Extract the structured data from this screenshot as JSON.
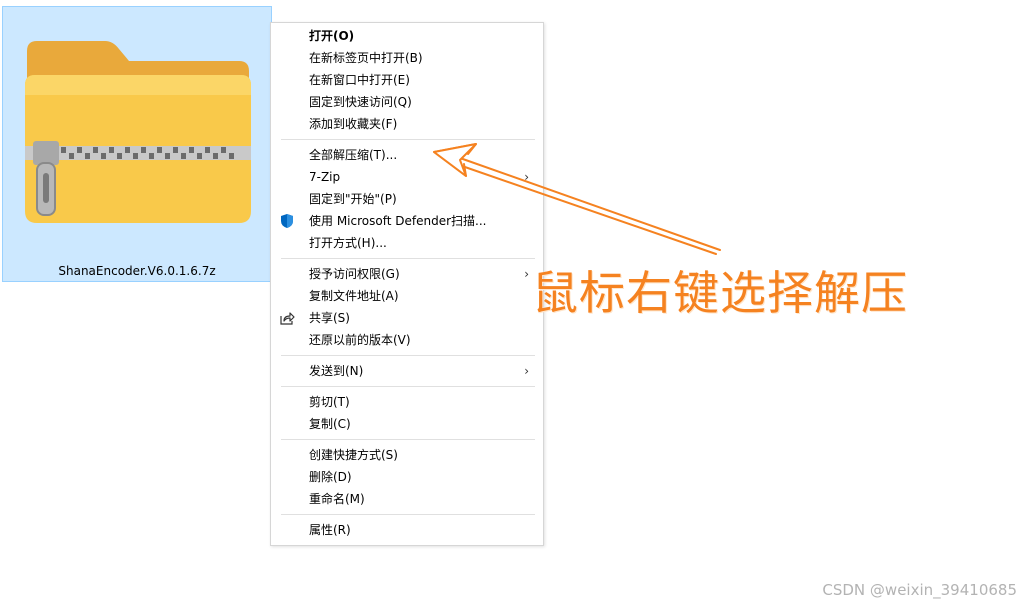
{
  "file": {
    "name": "ShanaEncoder.V6.0.1.6.7z"
  },
  "context_menu": {
    "groups": [
      [
        {
          "label": "打开(O)",
          "bold": true
        },
        {
          "label": "在新标签页中打开(B)"
        },
        {
          "label": "在新窗口中打开(E)"
        },
        {
          "label": "固定到快速访问(Q)"
        },
        {
          "label": "添加到收藏夹(F)"
        }
      ],
      [
        {
          "label": "全部解压缩(T)..."
        },
        {
          "label": "7-Zip",
          "submenu": true
        },
        {
          "label": "固定到\"开始\"(P)"
        },
        {
          "label": "使用 Microsoft Defender扫描...",
          "icon": "defender-shield-icon"
        },
        {
          "label": "打开方式(H)..."
        }
      ],
      [
        {
          "label": "授予访问权限(G)",
          "submenu": true
        },
        {
          "label": "复制文件地址(A)"
        },
        {
          "label": "共享(S)",
          "icon": "share-icon"
        },
        {
          "label": "还原以前的版本(V)"
        }
      ],
      [
        {
          "label": "发送到(N)",
          "submenu": true
        }
      ],
      [
        {
          "label": "剪切(T)"
        },
        {
          "label": "复制(C)"
        }
      ],
      [
        {
          "label": "创建快捷方式(S)"
        },
        {
          "label": "删除(D)"
        },
        {
          "label": "重命名(M)"
        }
      ],
      [
        {
          "label": "属性(R)"
        }
      ]
    ],
    "submenu_glyph": "›"
  },
  "annotation": {
    "text": "鼠标右键选择解压",
    "color": "#f58220"
  },
  "watermark": "CSDN @weixin_39410685",
  "colors": {
    "selection_bg": "#cce8ff",
    "selection_border": "#99d1ff",
    "folder_yellow": "#f9c94a",
    "defender_blue": "#0067c0"
  }
}
